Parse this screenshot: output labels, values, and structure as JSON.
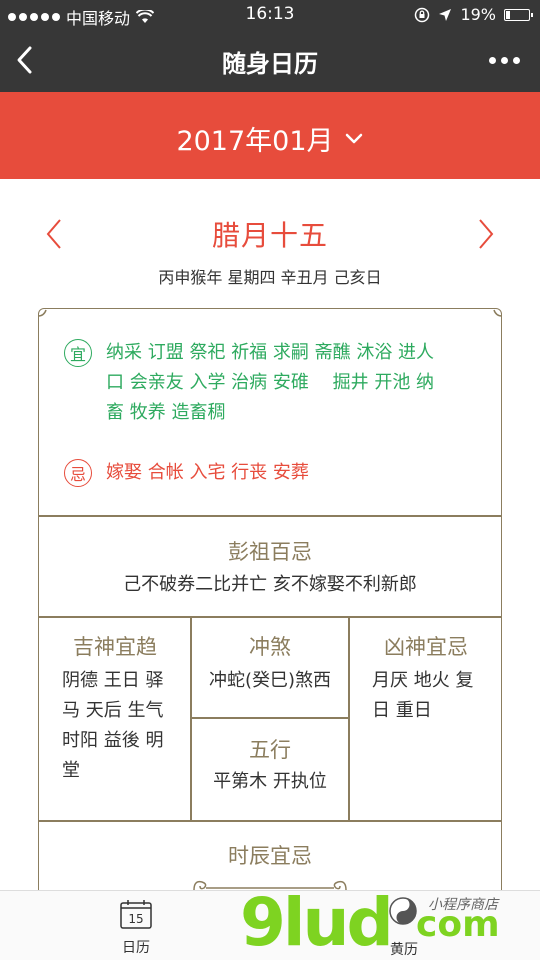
{
  "status_bar": {
    "carrier": "中国移动",
    "time": "16:13",
    "battery": "19%",
    "battery_level": 0.19
  },
  "nav": {
    "title": "随身日历"
  },
  "month_selector": {
    "label": "2017年01月"
  },
  "date_header": {
    "lunar_date": "腊月十五",
    "ganzhi": "丙申猴年 星期四 辛丑月 己亥日"
  },
  "almanac": {
    "yi_label": "宜",
    "yi_lines": [
      "纳采 订盟 祭祀 祈福 求嗣 斋醮 沐浴 进人",
      "口 会亲友 入学 治病 安碓　 掘井 开池 纳",
      "畜 牧养 造畜稠"
    ],
    "ji_label": "忌",
    "ji_text": "嫁娶 合帐 入宅 行丧 安葬",
    "pengzu": {
      "title": "彭祖百忌",
      "text": "己不破券二比并亡 亥不嫁娶不利新郎"
    },
    "jishen": {
      "title": "吉神宜趋",
      "lines": [
        "阴德 王日 驿",
        "马 天后 生气",
        "时阳 益後 明",
        "堂"
      ]
    },
    "chongsha": {
      "title": "冲煞",
      "text": "冲蛇(癸巳)煞西"
    },
    "wuxing": {
      "title": "五行",
      "text": "平第木 开执位"
    },
    "xiongshen": {
      "title": "凶神宜忌",
      "lines": [
        "月厌 地火 复",
        "日 重日"
      ]
    },
    "shichen": {
      "title": "时辰宜忌"
    }
  },
  "tabbar": {
    "calendar_day": "15",
    "calendar_label": "日历",
    "huangli_label": "黄历"
  },
  "watermark": {
    "brand": "9lud",
    "suffix": "com",
    "sub": "小程序商店"
  },
  "colors": {
    "nav_bg": "#373737",
    "accent_red": "#e74c3c",
    "yi_green": "#2eaa5f",
    "frame_gold": "#8b7d5e"
  }
}
